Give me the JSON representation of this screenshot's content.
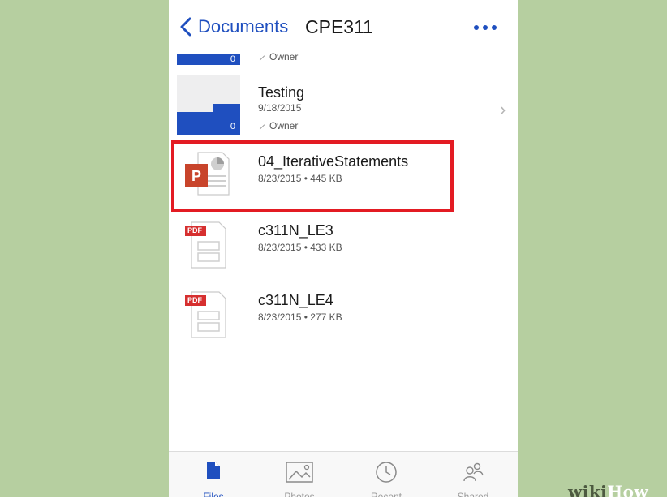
{
  "header": {
    "back_label": "Documents",
    "title": "CPE311"
  },
  "list": {
    "partial_item": {
      "owner": "Owner",
      "count": "0"
    },
    "folder": {
      "name": "Testing",
      "date": "9/18/2015",
      "owner": "Owner",
      "count": "0"
    },
    "files": [
      {
        "name": "04_IterativeStatements",
        "meta": "8/23/2015 • 445 KB",
        "type": "powerpoint",
        "icon_letter": "P"
      },
      {
        "name": "c311N_LE3",
        "meta": "8/23/2015 • 433 KB",
        "type": "pdf",
        "icon_label": "PDF"
      },
      {
        "name": "c311N_LE4",
        "meta": "8/23/2015 • 277 KB",
        "type": "pdf",
        "icon_label": "PDF"
      }
    ]
  },
  "tabbar": {
    "tabs": [
      {
        "label": "Files",
        "icon": "files-icon",
        "active": true
      },
      {
        "label": "Photos",
        "icon": "photos-icon",
        "active": false
      },
      {
        "label": "Recent",
        "icon": "clock-icon",
        "active": false
      },
      {
        "label": "Shared",
        "icon": "shared-icon",
        "active": false
      }
    ]
  },
  "watermark": {
    "part1": "wiki",
    "part2": "How"
  },
  "colors": {
    "accent": "#1f4fbf",
    "highlight": "#e31b23",
    "background": "#b6cfa0",
    "powerpoint": "#c8442b",
    "pdf": "#d62f2f"
  }
}
